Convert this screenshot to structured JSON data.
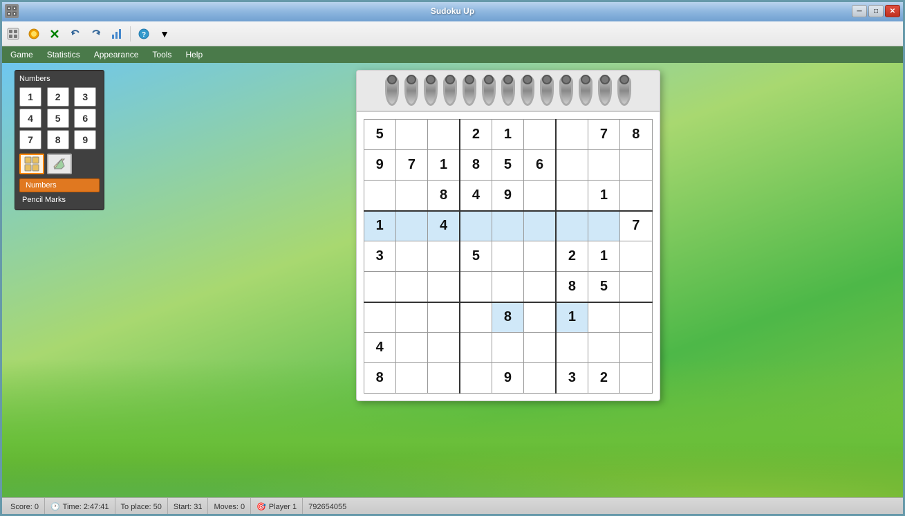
{
  "window": {
    "title": "Sudoku Up",
    "min_label": "─",
    "max_label": "□",
    "close_label": "✕"
  },
  "toolbar": {
    "buttons": [
      "🎮",
      "💾",
      "🔄",
      "↩",
      "↪",
      "📊",
      "❓",
      "▼"
    ]
  },
  "menubar": {
    "items": [
      "Game",
      "Statistics",
      "Appearance",
      "Tools",
      "Help"
    ]
  },
  "numbers_panel": {
    "title": "Numbers",
    "buttons": [
      "1",
      "2",
      "3",
      "4",
      "5",
      "6",
      "7",
      "8",
      "9"
    ],
    "mode_numbers": "Numbers",
    "mode_pencil": "Pencil Marks"
  },
  "sudoku": {
    "grid": [
      [
        {
          "v": "5",
          "h": false
        },
        {
          "v": "",
          "h": false
        },
        {
          "v": "",
          "h": false
        },
        {
          "v": "2",
          "h": false
        },
        {
          "v": "1",
          "h": false
        },
        {
          "v": "",
          "h": false
        },
        {
          "v": "",
          "h": false
        },
        {
          "v": "7",
          "h": false
        },
        {
          "v": "8",
          "h": false
        }
      ],
      [
        {
          "v": "9",
          "h": false
        },
        {
          "v": "7",
          "h": false
        },
        {
          "v": "1",
          "h": false
        },
        {
          "v": "8",
          "h": false
        },
        {
          "v": "5",
          "h": false
        },
        {
          "v": "6",
          "h": false
        },
        {
          "v": "",
          "h": false
        },
        {
          "v": "",
          "h": false
        },
        {
          "v": "",
          "h": false
        }
      ],
      [
        {
          "v": "",
          "h": false
        },
        {
          "v": "",
          "h": false
        },
        {
          "v": "8",
          "h": false
        },
        {
          "v": "4",
          "h": false
        },
        {
          "v": "9",
          "h": false
        },
        {
          "v": "",
          "h": false
        },
        {
          "v": "",
          "h": false
        },
        {
          "v": "1",
          "h": false
        },
        {
          "v": "",
          "h": false
        }
      ],
      [
        {
          "v": "1",
          "h": true
        },
        {
          "v": "",
          "h": true
        },
        {
          "v": "4",
          "h": true
        },
        {
          "v": "",
          "h": true
        },
        {
          "v": "",
          "h": true
        },
        {
          "v": "",
          "h": true
        },
        {
          "v": "",
          "h": true
        },
        {
          "v": "",
          "h": true
        },
        {
          "v": "7",
          "h": false
        }
      ],
      [
        {
          "v": "3",
          "h": false
        },
        {
          "v": "",
          "h": false
        },
        {
          "v": "",
          "h": false
        },
        {
          "v": "5",
          "h": false
        },
        {
          "v": "",
          "h": false
        },
        {
          "v": "",
          "h": false
        },
        {
          "v": "2",
          "h": false
        },
        {
          "v": "1",
          "h": false
        },
        {
          "v": "",
          "h": false
        }
      ],
      [
        {
          "v": "",
          "h": false
        },
        {
          "v": "",
          "h": false
        },
        {
          "v": "",
          "h": false
        },
        {
          "v": "",
          "h": false
        },
        {
          "v": "",
          "h": false
        },
        {
          "v": "",
          "h": false
        },
        {
          "v": "8",
          "h": false
        },
        {
          "v": "5",
          "h": false
        },
        {
          "v": "",
          "h": false
        }
      ],
      [
        {
          "v": "",
          "h": false
        },
        {
          "v": "",
          "h": false
        },
        {
          "v": "",
          "h": false
        },
        {
          "v": "",
          "h": false
        },
        {
          "v": "8",
          "h": true
        },
        {
          "v": "",
          "h": false
        },
        {
          "v": "1",
          "h": true
        },
        {
          "v": "",
          "h": false
        },
        {
          "v": "",
          "h": false
        }
      ],
      [
        {
          "v": "4",
          "h": false
        },
        {
          "v": "",
          "h": false
        },
        {
          "v": "",
          "h": false
        },
        {
          "v": "",
          "h": false
        },
        {
          "v": "",
          "h": false
        },
        {
          "v": "",
          "h": false
        },
        {
          "v": "",
          "h": false
        },
        {
          "v": "",
          "h": false
        },
        {
          "v": "",
          "h": false
        }
      ],
      [
        {
          "v": "8",
          "h": false
        },
        {
          "v": "",
          "h": false
        },
        {
          "v": "",
          "h": false
        },
        {
          "v": "",
          "h": false
        },
        {
          "v": "9",
          "h": false
        },
        {
          "v": "",
          "h": false
        },
        {
          "v": "3",
          "h": false
        },
        {
          "v": "2",
          "h": false
        },
        {
          "v": "",
          "h": false
        }
      ]
    ]
  },
  "statusbar": {
    "score": "Score: 0",
    "time": "Time: 2:47:41",
    "to_place": "To place: 50",
    "start": "Start: 31",
    "moves": "Moves: 0",
    "player": "Player 1",
    "game_id": "792654055"
  },
  "icons": {
    "game": "🎮",
    "save": "💾",
    "undo": "↩",
    "redo": "↪",
    "stats": "📊",
    "help": "❓",
    "timer": "🕐",
    "player": "🎯",
    "eraser": "🧹",
    "pencil": "✏️",
    "grid_icon": "⊞"
  }
}
